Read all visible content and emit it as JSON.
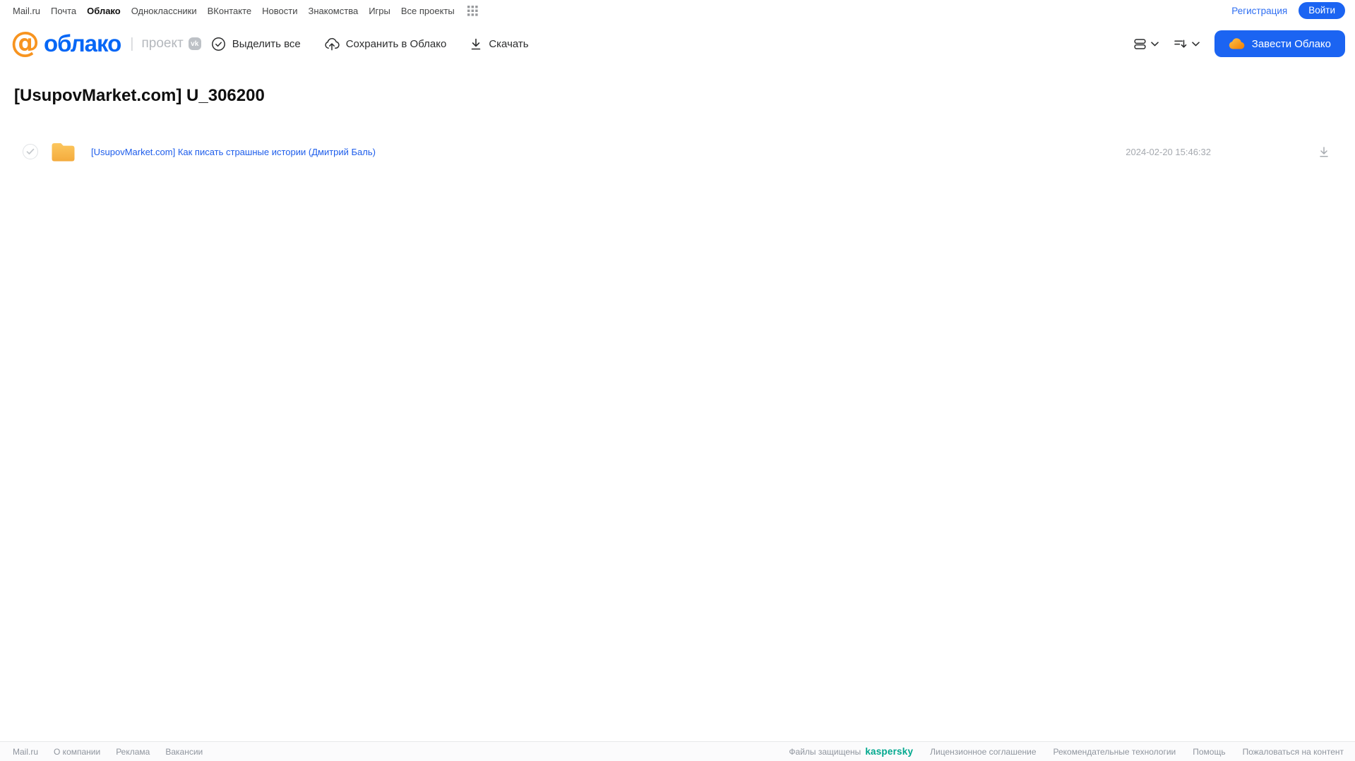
{
  "top_nav": {
    "links": [
      "Mail.ru",
      "Почта",
      "Облако",
      "Одноклассники",
      "ВКонтакте",
      "Новости",
      "Знакомства",
      "Игры",
      "Все проекты"
    ],
    "active_link": "Облако",
    "registration_label": "Регистрация",
    "login_label": "Войти"
  },
  "header": {
    "logo_at": "@",
    "logo_word": "облако",
    "project_label": "проект",
    "vk_badge": "vk",
    "toolbar": {
      "select_all_label": "Выделить все",
      "save_to_cloud_label": "Сохранить в Облако",
      "download_label": "Скачать"
    },
    "get_cloud_button_label": "Завести Облако"
  },
  "main": {
    "page_title": "[UsupovMarket.com] U_306200",
    "files": [
      {
        "name": "[UsupovMarket.com] Как писать страшные истории (Дмитрий Баль)",
        "date": "2024-02-20 15:46:32",
        "type": "folder"
      }
    ]
  },
  "footer": {
    "left_links": [
      "Mail.ru",
      "О компании",
      "Реклама",
      "Вакансии"
    ],
    "protected_label": "Файлы защищены",
    "kaspersky_label": "kaspersky",
    "right_links": [
      "Лицензионное соглашение",
      "Рекомендательные технологии",
      "Помощь",
      "Пожаловаться на контент"
    ]
  },
  "colors": {
    "accent_blue": "#1b64f2",
    "link_blue": "#1d5deb",
    "logo_blue": "#0667f6",
    "logo_orange": "#f79420",
    "folder_yellow": "#f8b84e",
    "kaspersky_teal": "#00a88e",
    "muted_gray": "#a5a9af"
  }
}
